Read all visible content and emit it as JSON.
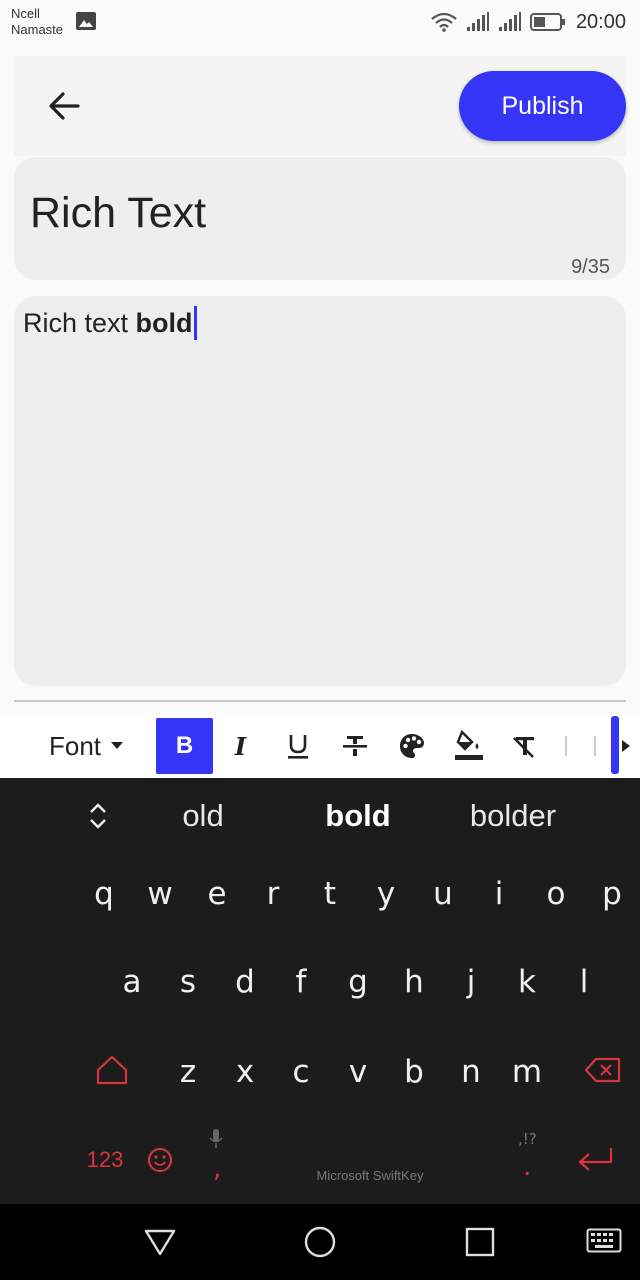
{
  "status_bar": {
    "carrier_line1": "Ncell",
    "carrier_line2": "Namaste",
    "time": "20:00",
    "icons": [
      "gallery-icon",
      "wifi-icon",
      "signal-icon",
      "signal-icon",
      "battery-icon"
    ]
  },
  "app_bar": {
    "back_icon": "arrow-left-icon",
    "publish_label": "Publish"
  },
  "title_field": {
    "value": "Rich Text",
    "counter": "9/35"
  },
  "body_field": {
    "plain_text": "Rich text ",
    "bold_text": "bold"
  },
  "toolbar": {
    "font_label": "Font",
    "buttons": [
      {
        "name": "bold",
        "glyph": "B",
        "active": true
      },
      {
        "name": "italic",
        "glyph": "I",
        "active": false
      },
      {
        "name": "underline",
        "glyph": "U",
        "active": false
      },
      {
        "name": "strikethrough",
        "glyph": "S",
        "active": false
      },
      {
        "name": "text-color",
        "icon": "palette-icon",
        "active": false
      },
      {
        "name": "background-color",
        "icon": "fill-bucket-icon",
        "active": false
      },
      {
        "name": "clear-format",
        "icon": "clear-format-icon",
        "active": false
      }
    ],
    "accent": "#3535f8"
  },
  "keyboard": {
    "suggestions": [
      "old",
      "bold",
      "bolder"
    ],
    "row1": [
      "q",
      "w",
      "e",
      "r",
      "t",
      "y",
      "u",
      "i",
      "o",
      "p"
    ],
    "row2": [
      "a",
      "s",
      "d",
      "f",
      "g",
      "h",
      "j",
      "k",
      "l"
    ],
    "row3": [
      "z",
      "x",
      "c",
      "v",
      "b",
      "n",
      "m"
    ],
    "numbers_label": "123",
    "comma": ",",
    "period": ".",
    "punct_hint": ",!?",
    "brand": "Microsoft SwiftKey",
    "accent": "#d8343e"
  },
  "nav_bar": {
    "icons": [
      "back-triangle-icon",
      "home-circle-icon",
      "recents-square-icon",
      "keyboard-icon"
    ]
  }
}
